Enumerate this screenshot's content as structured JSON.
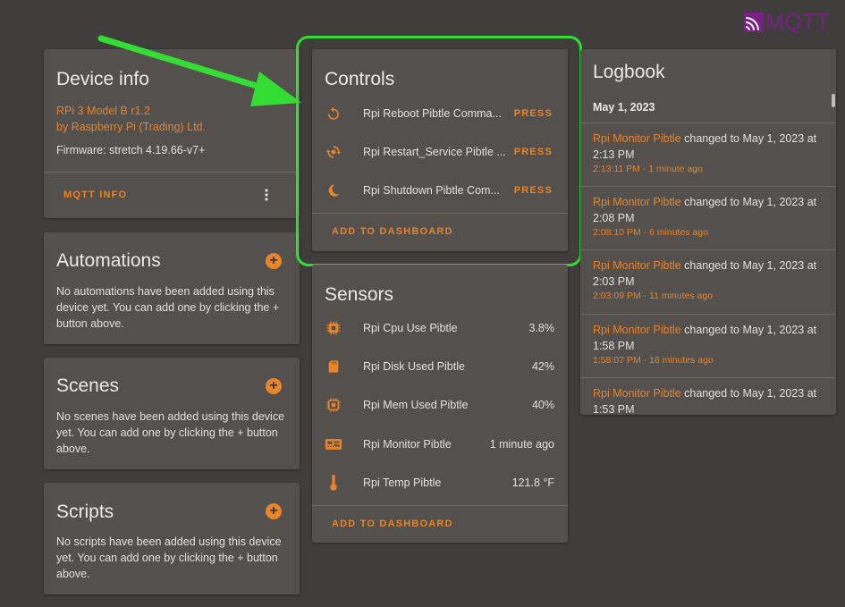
{
  "brand": {
    "logo_text": "MQTT",
    "color": "#7a1f86"
  },
  "colors": {
    "accent": "#e8842a",
    "card": "#53504d",
    "background": "#403e3c",
    "highlight": "#33dd33"
  },
  "device_info": {
    "title": "Device info",
    "model": "RPi 3 Model B r1.2",
    "manufacturer": "by Raspberry Pi (Trading) Ltd.",
    "firmware": "Firmware: stretch 4.19.66-v7+",
    "mqtt_info_label": "MQTT INFO",
    "menu_icon": "more-vertical-icon"
  },
  "automations": {
    "title": "Automations",
    "text": "No automations have been added using this device yet. You can add one by clicking the + button above."
  },
  "scenes": {
    "title": "Scenes",
    "text": "No scenes have been added using this device yet. You can add one by clicking the + button above."
  },
  "scripts": {
    "title": "Scripts",
    "text": "No scripts have been added using this device yet. You can add one by clicking the + button above."
  },
  "controls": {
    "title": "Controls",
    "items": [
      {
        "icon": "restart-icon",
        "label": "Rpi Reboot Pibtle Comma...",
        "action": "PRESS"
      },
      {
        "icon": "service-restart-icon",
        "label": "Rpi Restart_Service Pibtle ...",
        "action": "PRESS"
      },
      {
        "icon": "moon-icon",
        "label": "Rpi Shutdown Pibtle Com...",
        "action": "PRESS"
      }
    ],
    "add_label": "ADD TO DASHBOARD"
  },
  "sensors": {
    "title": "Sensors",
    "items": [
      {
        "icon": "cpu-icon",
        "label": "Rpi Cpu Use Pibtle",
        "value": "3.8%"
      },
      {
        "icon": "sd-card-icon",
        "label": "Rpi Disk Used Pibtle",
        "value": "42%"
      },
      {
        "icon": "chip-icon",
        "label": "Rpi Mem Used Pibtle",
        "value": "40%"
      },
      {
        "icon": "board-icon",
        "label": "Rpi Monitor Pibtle",
        "value": "1 minute ago"
      },
      {
        "icon": "thermometer-icon",
        "label": "Rpi Temp Pibtle",
        "value": "121.8 °F"
      }
    ],
    "add_label": "ADD TO DASHBOARD"
  },
  "logbook": {
    "title": "Logbook",
    "date": "May 1, 2023",
    "entries": [
      {
        "entity": "Rpi Monitor Pibtle",
        "text": " changed to May 1, 2023 at",
        "text2": "2:13 PM",
        "time": "2:13:11 PM - 1 minute ago"
      },
      {
        "entity": "Rpi Monitor Pibtle",
        "text": " changed to May 1, 2023 at",
        "text2": "2:08 PM",
        "time": "2:08:10 PM - 6 minutes ago"
      },
      {
        "entity": "Rpi Monitor Pibtle",
        "text": " changed to May 1, 2023 at",
        "text2": "2:03 PM",
        "time": "2:03:09 PM - 11 minutes ago"
      },
      {
        "entity": "Rpi Monitor Pibtle",
        "text": " changed to May 1, 2023 at",
        "text2": "1:58 PM",
        "time": "1:58:07 PM - 16 minutes ago"
      },
      {
        "entity": "Rpi Monitor Pibtle",
        "text": " changed to May 1, 2023 at",
        "text2": "1:53 PM",
        "time": ""
      }
    ]
  }
}
